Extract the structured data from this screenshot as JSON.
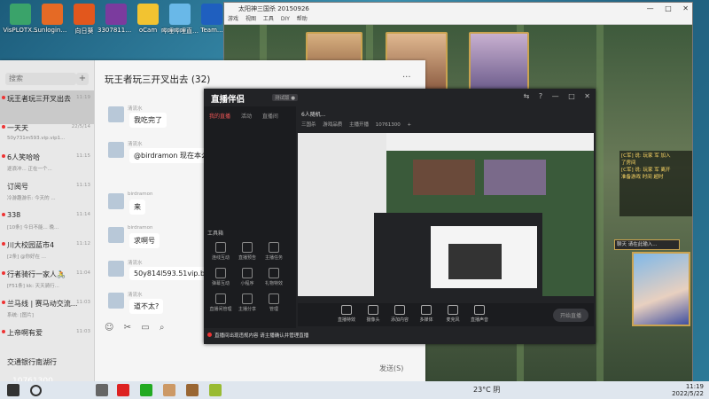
{
  "desktop_icons": [
    {
      "label": "VisPLOTX...",
      "color": "#3aa36a"
    },
    {
      "label": "SunloginO...",
      "color": "#e56a25"
    },
    {
      "label": "向日葵",
      "color": "#e2571d"
    },
    {
      "label": "33078119...",
      "color": "#7b3b9e"
    },
    {
      "label": "oCam",
      "color": "#f2c331"
    },
    {
      "label": "哔哩哔哩直播姬",
      "color": "#69b8e8"
    },
    {
      "label": "Team...",
      "color": "#1f5fbf"
    }
  ],
  "game": {
    "title": "太阳神三国杀 20150926",
    "menu": [
      "游戏",
      "视图",
      "工具",
      "DIY",
      "帮助"
    ],
    "controls": [
      "—",
      "□",
      "✕"
    ],
    "chat_log": [
      "[C军] 说: 玩家 军 加入",
      "了房间",
      "[C军] 说: 玩家 军 离开",
      "准备游戏 时间 超时"
    ],
    "input_placeholder": "聊天 请在此输入..."
  },
  "qq": {
    "search_placeholder": "搜索",
    "plus": "+",
    "conversations": [
      {
        "name": "玩王者玩三开叉出去",
        "time": "11:19",
        "preview": "",
        "active": true,
        "unread": true
      },
      {
        "name": "一天天",
        "time": "22/5/14",
        "preview": "50y731m593.vip.vip1...",
        "active": false,
        "unread": true
      },
      {
        "name": "6人笑哈哈",
        "time": "11:15",
        "preview": "逐浪冲... 正在一个...",
        "active": false,
        "unread": true
      },
      {
        "name": "订阅号",
        "time": "11:13",
        "preview": "冷游趣游乐: 今天的 ...",
        "active": false,
        "unread": false
      },
      {
        "name": "338",
        "time": "11:14",
        "preview": "[10条] 今日不能...  晚...",
        "active": false,
        "unread": true
      },
      {
        "name": "川大校园蓝市4",
        "time": "11:12",
        "preview": "[2条] @你好在 ...",
        "active": false,
        "unread": true
      },
      {
        "name": "行者骑行一家人🚴",
        "time": "11:04",
        "preview": "[F51条] kk: 天天骑行...",
        "active": false,
        "unread": true
      },
      {
        "name": "兰马线 | 赛马动交流...",
        "time": "11:03",
        "preview": "系统: [图片]",
        "active": false,
        "unread": true
      },
      {
        "name": "上帝啊有爱",
        "time": "11:03",
        "preview": "",
        "active": false,
        "unread": true
      },
      {
        "name": "交通银行南湖行",
        "time": "",
        "preview": "",
        "active": false,
        "unread": false
      }
    ],
    "chat_title": "玩王者玩三开叉出去 (32)",
    "more": "···",
    "messages": [
      {
        "sender": "清流水",
        "text": "我吃完了"
      },
      {
        "sender": "清流水",
        "text": "@birdramon 现在本么"
      },
      {
        "sender": "birdramon",
        "text": "来"
      },
      {
        "sender": "birdramon",
        "text": "求啊号"
      },
      {
        "sender": "清流水",
        "text": "50y814l593.51vip.biz"
      },
      {
        "sender": "清流水",
        "text": "道不太?"
      }
    ],
    "tools": [
      "☺",
      "✂",
      "▭",
      "⌕"
    ],
    "send_label": "发送(S)",
    "user_id": "10761300"
  },
  "live": {
    "logo": "直播伴侣",
    "version": "测试版 ●",
    "controls": [
      "⇆",
      "?",
      "—",
      "□",
      "✕"
    ],
    "tabs": [
      "我的直播",
      "活动",
      "直播间"
    ],
    "main_head": "6人随机...",
    "sub_tabs": [
      "三国杀",
      "游戏品质",
      "主播开播",
      "10761300",
      "+"
    ],
    "toolbox_title": "工具箱",
    "tools": [
      "连线互动",
      "直播预告",
      "主播任务",
      "弹幕互动",
      "小程序",
      "礼物特效",
      "直播间管理",
      "主播分享",
      "管理"
    ],
    "bar": [
      "直播特效",
      "摄像头",
      "添加内容",
      "多媒体",
      "麦克风",
      "直播声音"
    ],
    "go_label": "开始直播",
    "note": "直播间出现违规内容 请主播确认并管理直播"
  },
  "taskbar": {
    "weather": "23°C 阴",
    "time": "11:19",
    "date": "2022/5/22"
  }
}
